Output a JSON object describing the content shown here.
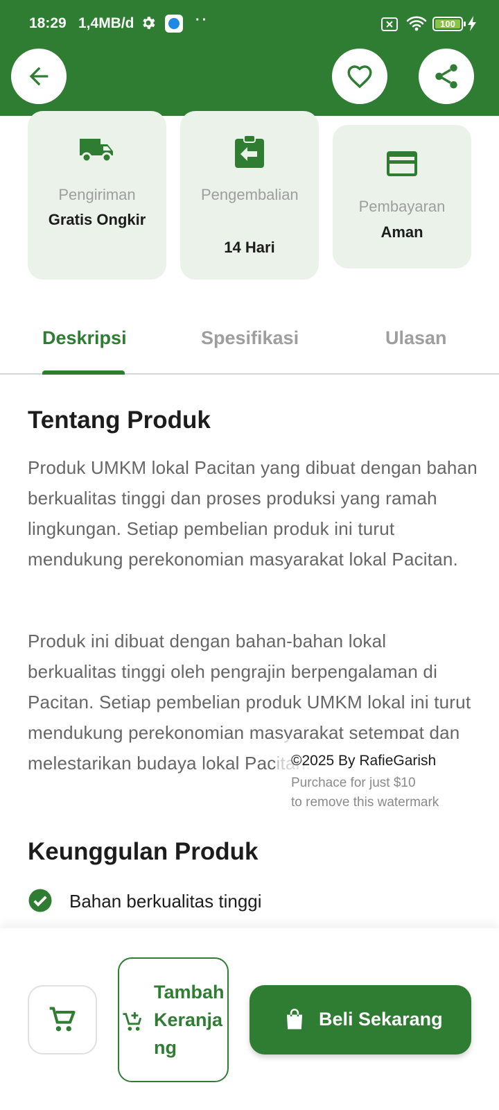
{
  "status_bar": {
    "time": "18:29",
    "data_speed": "1,4MB/d",
    "dots": "··",
    "battery": "100"
  },
  "header": {
    "back_icon": "arrow-left-icon",
    "favorite_icon": "heart-outline-icon",
    "share_icon": "share-icon"
  },
  "info_cards": [
    {
      "icon": "truck-icon",
      "label": "Pengiriman",
      "value": "Gratis Ongkir"
    },
    {
      "icon": "return-box-icon",
      "label": "Pengembalian",
      "value": "14 Hari"
    },
    {
      "icon": "credit-card-icon",
      "label": "Pembayaran",
      "value": "Aman"
    }
  ],
  "tabs": [
    {
      "label": "Deskripsi",
      "active": true
    },
    {
      "label": "Spesifikasi",
      "active": false
    },
    {
      "label": "Ulasan",
      "active": false
    }
  ],
  "description": {
    "title": "Tentang Produk",
    "paragraph1": "Produk UMKM lokal Pacitan yang dibuat dengan bahan berkualitas tinggi dan proses produksi yang ramah lingkungan. Setiap pembelian produk ini turut mendukung perekonomian masyarakat lokal Pacitan.",
    "paragraph2": "Produk ini dibuat dengan bahan-bahan lokal berkualitas tinggi oleh pengrajin berpengalaman di Pacitan. Setiap pembelian produk UMKM lokal ini turut mendukung perekonomian masyarakat setempat dan melestarikan budaya lokal Pacitan."
  },
  "watermark": {
    "line1": "©2025 By RafieGarish",
    "line2": "Purchace for just $10",
    "line3": "to remove this watermark"
  },
  "advantages": {
    "title": "Keunggulan Produk",
    "items": [
      "Bahan berkualitas tinggi"
    ]
  },
  "bottom_actions": {
    "cart_icon": "shopping-cart-icon",
    "add_to_cart_label": "Tambah Keranjang",
    "buy_now_label": "Beli Sekarang"
  },
  "colors": {
    "primary": "#2e7d32",
    "card_background": "#eaf2ea",
    "muted_text": "#9e9e9e"
  }
}
